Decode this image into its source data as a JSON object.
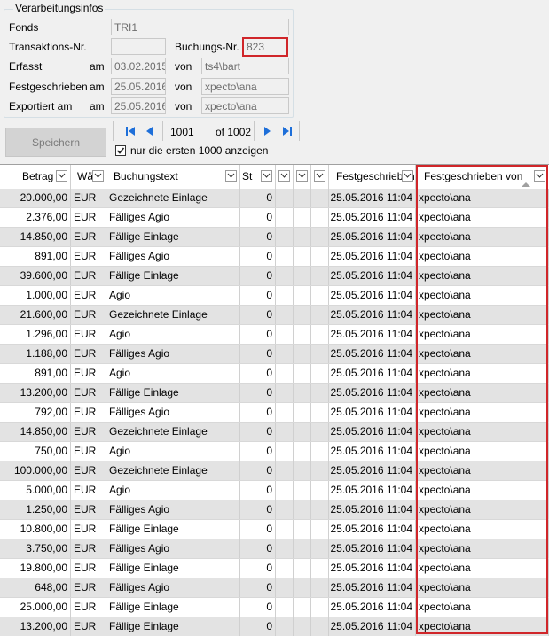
{
  "group": {
    "title": "Verarbeitungsinfos",
    "fonds_label": "Fonds",
    "fonds_value": "TRI1",
    "transaktion_label": "Transaktions-Nr.",
    "transaktion_value": "",
    "buchung_label": "Buchungs-Nr.",
    "buchung_value": "823",
    "erfasst_label": "Erfasst",
    "erfasst_am": "am",
    "erfasst_date": "03.02.2015",
    "erfasst_von": "von",
    "erfasst_user": "ts4\\bart",
    "fest_label": "Festgeschrieben",
    "fest_am": "am",
    "fest_date": "25.05.2016",
    "fest_von": "von",
    "fest_user": "xpecto\\ana",
    "export_label": "Exportiert am",
    "export_am": "am",
    "export_date": "25.05.2016",
    "export_von": "von",
    "export_user": "xpecto\\ana"
  },
  "save_label": "Speichern",
  "nav": {
    "current": "1001",
    "total": "of 1002"
  },
  "checkbox": {
    "label": "nur die ersten 1000 anzeigen",
    "checked": true
  },
  "columns": [
    "Betrag",
    "Wä",
    "Buchungstext",
    "St",
    "",
    "",
    "",
    "Festgeschrieben",
    "Festgeschrieben von"
  ],
  "rows": [
    [
      "20.000,00",
      "EUR",
      "Gezeichnete Einlage",
      "0",
      "25.05.2016 11:04",
      "xpecto\\ana"
    ],
    [
      "2.376,00",
      "EUR",
      "Fälliges Agio",
      "0",
      "25.05.2016 11:04",
      "xpecto\\ana"
    ],
    [
      "14.850,00",
      "EUR",
      "Fällige Einlage",
      "0",
      "25.05.2016 11:04",
      "xpecto\\ana"
    ],
    [
      "891,00",
      "EUR",
      "Fälliges Agio",
      "0",
      "25.05.2016 11:04",
      "xpecto\\ana"
    ],
    [
      "39.600,00",
      "EUR",
      "Fällige Einlage",
      "0",
      "25.05.2016 11:04",
      "xpecto\\ana"
    ],
    [
      "1.000,00",
      "EUR",
      "Agio",
      "0",
      "25.05.2016 11:04",
      "xpecto\\ana"
    ],
    [
      "21.600,00",
      "EUR",
      "Gezeichnete Einlage",
      "0",
      "25.05.2016 11:04",
      "xpecto\\ana"
    ],
    [
      "1.296,00",
      "EUR",
      "Agio",
      "0",
      "25.05.2016 11:04",
      "xpecto\\ana"
    ],
    [
      "1.188,00",
      "EUR",
      "Fälliges Agio",
      "0",
      "25.05.2016 11:04",
      "xpecto\\ana"
    ],
    [
      "891,00",
      "EUR",
      "Agio",
      "0",
      "25.05.2016 11:04",
      "xpecto\\ana"
    ],
    [
      "13.200,00",
      "EUR",
      "Fällige Einlage",
      "0",
      "25.05.2016 11:04",
      "xpecto\\ana"
    ],
    [
      "792,00",
      "EUR",
      "Fälliges Agio",
      "0",
      "25.05.2016 11:04",
      "xpecto\\ana"
    ],
    [
      "14.850,00",
      "EUR",
      "Gezeichnete Einlage",
      "0",
      "25.05.2016 11:04",
      "xpecto\\ana"
    ],
    [
      "750,00",
      "EUR",
      "Agio",
      "0",
      "25.05.2016 11:04",
      "xpecto\\ana"
    ],
    [
      "100.000,00",
      "EUR",
      "Gezeichnete Einlage",
      "0",
      "25.05.2016 11:04",
      "xpecto\\ana"
    ],
    [
      "5.000,00",
      "EUR",
      "Agio",
      "0",
      "25.05.2016 11:04",
      "xpecto\\ana"
    ],
    [
      "1.250,00",
      "EUR",
      "Fälliges Agio",
      "0",
      "25.05.2016 11:04",
      "xpecto\\ana"
    ],
    [
      "10.800,00",
      "EUR",
      "Fällige Einlage",
      "0",
      "25.05.2016 11:04",
      "xpecto\\ana"
    ],
    [
      "3.750,00",
      "EUR",
      "Fälliges Agio",
      "0",
      "25.05.2016 11:04",
      "xpecto\\ana"
    ],
    [
      "19.800,00",
      "EUR",
      "Fällige Einlage",
      "0",
      "25.05.2016 11:04",
      "xpecto\\ana"
    ],
    [
      "648,00",
      "EUR",
      "Fälliges Agio",
      "0",
      "25.05.2016 11:04",
      "xpecto\\ana"
    ],
    [
      "25.000,00",
      "EUR",
      "Fällige Einlage",
      "0",
      "25.05.2016 11:04",
      "xpecto\\ana"
    ],
    [
      "13.200,00",
      "EUR",
      "Fällige Einlage",
      "0",
      "25.05.2016 11:04",
      "xpecto\\ana"
    ]
  ],
  "colors": {
    "highlight": "#d0262a",
    "nav_icon": "#1e6fd9",
    "row_alt": "#e3e3e3"
  },
  "icons": [
    "first-page-icon",
    "prev-page-icon",
    "next-page-icon",
    "last-page-icon",
    "checkmark-icon",
    "chevron-down-icon",
    "sort-ascending-icon"
  ]
}
